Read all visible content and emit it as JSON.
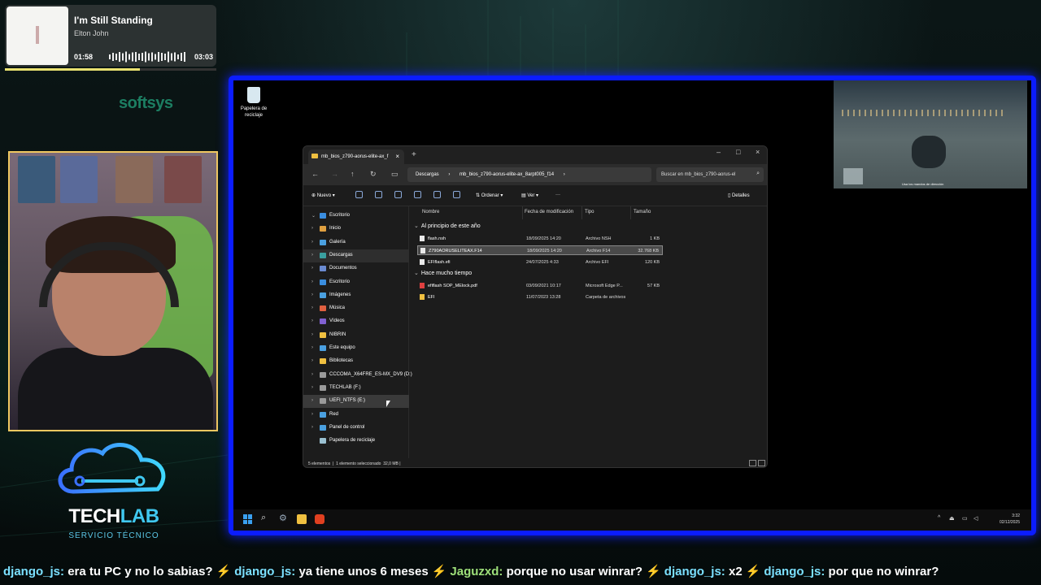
{
  "now_playing": {
    "title": "I'm Still Standing",
    "artist": "Elton John",
    "elapsed": "01:58",
    "duration": "03:03",
    "progress": 0.64
  },
  "overlay_brand": "softsys",
  "logo": {
    "tech": "TECH",
    "lab": "LAB",
    "subtitle": "SERVICIO TÉCNICO"
  },
  "desktop": {
    "recycle_bin_label": "Papelera de reciclaje"
  },
  "game_overlay": {
    "caption": "Usa los mandos de dirección"
  },
  "explorer": {
    "tab_title": "mb_bios_z790-aorus-elite-ax_f",
    "breadcrumb": [
      "Descargas",
      "mb_bios_z790-aorus-elite-ax_8arpt005_f14"
    ],
    "search_placeholder": "Buscar en mb_bios_z790-aorus-el",
    "toolbar": {
      "new": "Nuevo",
      "sort": "Ordenar",
      "view": "Ver",
      "more": "···",
      "details": "Detalles"
    },
    "nav": [
      {
        "label": "Escritorio",
        "icon": "desktop-icon",
        "color": "#3a8ee0"
      },
      {
        "label": "Inicio",
        "icon": "home-icon",
        "color": "#e0a040"
      },
      {
        "label": "Galería",
        "icon": "gallery-icon",
        "color": "#4aa0e0"
      },
      {
        "label": "Descargas",
        "icon": "download-icon",
        "color": "#3aa0a0"
      },
      {
        "label": "Documentos",
        "icon": "documents-icon",
        "color": "#6a8ad0"
      },
      {
        "label": "Escritorio",
        "icon": "desktop-icon",
        "color": "#3a8ee0"
      },
      {
        "label": "Imágenes",
        "icon": "pictures-icon",
        "color": "#4aa0e0"
      },
      {
        "label": "Música",
        "icon": "music-icon",
        "color": "#e06040"
      },
      {
        "label": "Vídeos",
        "icon": "videos-icon",
        "color": "#8060d0"
      },
      {
        "label": "NIBRIN",
        "icon": "folder-icon",
        "color": "#f0c040"
      },
      {
        "label": "Este equipo",
        "icon": "computer-icon",
        "color": "#4aa0e0"
      },
      {
        "label": "Bibliotecas",
        "icon": "library-icon",
        "color": "#f0c040"
      },
      {
        "label": "CCCOMA_X64FRE_ES-MX_DV9 (D:)",
        "icon": "drive-icon",
        "color": "#9a9a9a"
      },
      {
        "label": "TECHLAB (F:)",
        "icon": "drive-icon",
        "color": "#9a9a9a"
      },
      {
        "label": "UEFI_NTFS (E:)",
        "icon": "drive-icon",
        "color": "#9a9a9a"
      },
      {
        "label": "Red",
        "icon": "network-icon",
        "color": "#4aa0e0"
      },
      {
        "label": "Panel de control",
        "icon": "control-panel-icon",
        "color": "#4aa0e0"
      },
      {
        "label": "Papelera de reciclaje",
        "icon": "recycle-bin-icon",
        "color": "#9ac0d0"
      }
    ],
    "columns": [
      "Nombre",
      "Fecha de modificación",
      "Tipo",
      "Tamaño"
    ],
    "groups": [
      {
        "label": "Al principio de este año",
        "files": [
          {
            "name": "flash.nsh",
            "date": "18/09/2025 14:20",
            "type": "Archivo NSH",
            "size": "1 KB",
            "icon_color": "#e8e8e8"
          },
          {
            "name": "Z790AORUSELITEAX.F14",
            "date": "18/09/2025 14:20",
            "type": "Archivo F14",
            "size": "32.768 KB",
            "icon_color": "#e8e8e8",
            "selected": true
          },
          {
            "name": "EFIflash.efi",
            "date": "24/07/2025 4:33",
            "type": "Archivo EFI",
            "size": "120 KB",
            "icon_color": "#e8e8e8"
          }
        ]
      },
      {
        "label": "Hace mucho tiempo",
        "files": [
          {
            "name": "efiflash SOP_MElock.pdf",
            "date": "03/09/2021 10:17",
            "type": "Microsoft Edge P...",
            "size": "57 KB",
            "icon_color": "#e04040"
          },
          {
            "name": "EFI",
            "date": "11/07/2023 13:28",
            "type": "Carpeta de archivos",
            "size": "",
            "icon_color": "#f0c040"
          }
        ]
      }
    ],
    "status": {
      "count": "5 elementos",
      "selected": "1 elemento seleccionado",
      "size": "32,0 MB"
    }
  },
  "taskbar": {
    "time": "3:32",
    "date": "02/12/2025"
  },
  "chat": [
    {
      "user": "django_js:",
      "msg": "era tu PC y no lo sabias?"
    },
    {
      "user": "django_js:",
      "msg": "ya tiene unos 6 meses"
    },
    {
      "user": "Jaguzxd:",
      "msg": "porque no usar winrar?"
    },
    {
      "user": "django_js:",
      "msg": "x2"
    },
    {
      "user": "django_js:",
      "msg": "por que no winrar?"
    }
  ]
}
